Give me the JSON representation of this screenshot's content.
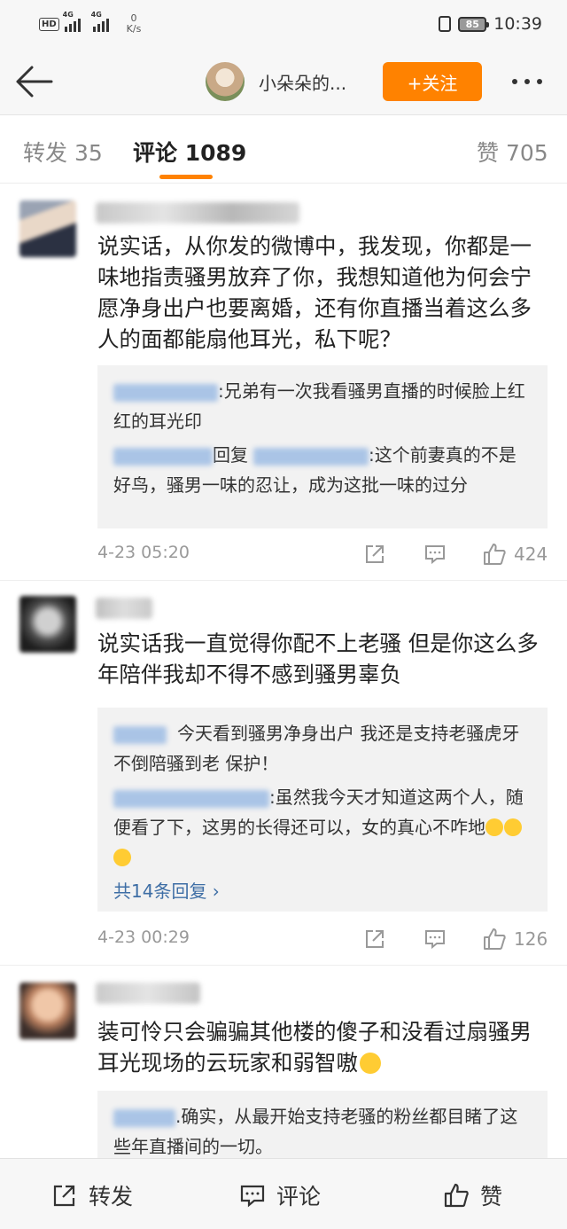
{
  "status_bar": {
    "network_1": "4G",
    "network_2": "4G",
    "speed_value": "0",
    "speed_unit": "K/s",
    "battery": "85",
    "time": "10:39"
  },
  "nav": {
    "title": "小朵朵的...",
    "follow_label": "+关注"
  },
  "tabs": [
    {
      "label": "转发 35"
    },
    {
      "label": "评论 1089"
    },
    {
      "label": "赞 705"
    }
  ],
  "comments": [
    {
      "text": "说实话，从你发的微博中，我发现，你都是一味地指责骚男放弃了你，我想知道他为何会宁愿净身出户也要离婚，还有你直播当着这么多人的面都能扇他耳光，私下呢？",
      "replies": [
        {
          "text": ":兄弟有一次我看骚男直播的时候脸上红红的耳光印"
        },
        {
          "reply_word": "回复",
          "text": ":这个前妻真的不是好鸟，骚男一味的忍让，成为这批一味的过分"
        }
      ],
      "time": "4-23 05:20",
      "likes": "424"
    },
    {
      "text": "说实话我一直觉得你配不上老骚 但是你这么多年陪伴我却不得不感到骚男辜负",
      "replies": [
        {
          "text": "今天看到骚男净身出户 我还是支持老骚虎牙不倒陪骚到老 保护！"
        },
        {
          "text": ":虽然我今天才知道这两个人，随便看了下，这男的长得还可以，女的真心不咋地"
        }
      ],
      "more_replies": "共14条回复 ›",
      "time": "4-23 00:29",
      "likes": "126"
    },
    {
      "text": "装可怜只会骗骗其他楼的傻子和没看过扇骚男耳光现场的云玩家和弱智嗷",
      "replies": [
        {
          "text": ".确实，从最开始支持老骚的粉丝都目睹了这些年直播间的一切。"
        }
      ]
    }
  ],
  "bottom_bar": {
    "repost": "转发",
    "comment": "评论",
    "like": "赞"
  }
}
